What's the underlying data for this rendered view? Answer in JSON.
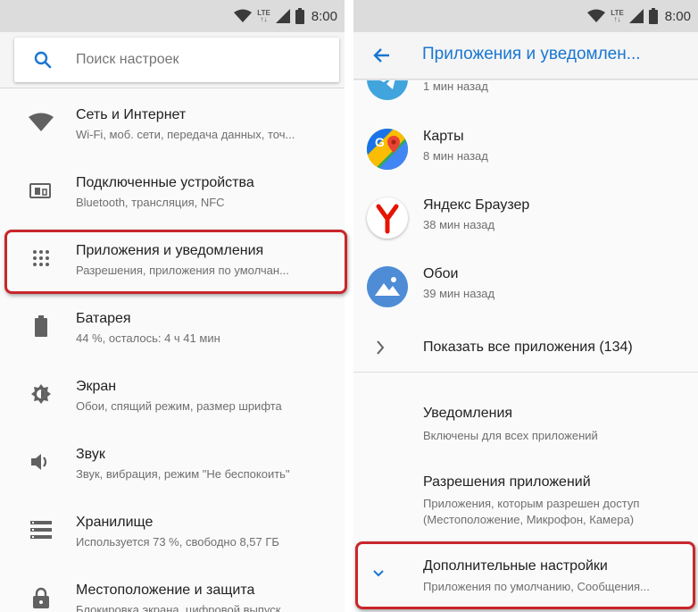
{
  "status": {
    "network": "LTE",
    "time": "8:00"
  },
  "left": {
    "search": {
      "placeholder": "Поиск настроек"
    },
    "items": [
      {
        "title": "Сеть и Интернет",
        "subtitle": "Wi-Fi, моб. сети, передача данных, точ...",
        "icon": "wifi-icon"
      },
      {
        "title": "Подключенные устройства",
        "subtitle": "Bluetooth, трансляция, NFC",
        "icon": "devices-icon"
      },
      {
        "title": "Приложения и уведомления",
        "subtitle": "Разрешения, приложения по умолчан...",
        "icon": "apps-icon"
      },
      {
        "title": "Батарея",
        "subtitle": "44 %, осталось: 4 ч 41 мин",
        "icon": "battery-icon"
      },
      {
        "title": "Экран",
        "subtitle": "Обои, спящий режим, размер шрифта",
        "icon": "brightness-icon"
      },
      {
        "title": "Звук",
        "subtitle": "Звук, вибрация, режим \"Не беспокоить\"",
        "icon": "volume-icon"
      },
      {
        "title": "Хранилище",
        "subtitle": "Используется 73 %, свободно 8,57 ГБ",
        "icon": "storage-icon"
      },
      {
        "title": "Местоположение и защита",
        "subtitle": "Блокировка экрана, цифровой выпуск...",
        "icon": "lock-icon"
      }
    ]
  },
  "right": {
    "title": "Приложения и уведомлен...",
    "apps": [
      {
        "name": "",
        "time": "1 мин назад",
        "icon": "telegram-icon"
      },
      {
        "name": "Карты",
        "time": "8 мин назад",
        "icon": "maps-icon"
      },
      {
        "name": "Яндекс Браузер",
        "time": "38 мин назад",
        "icon": "yandex-browser-icon"
      },
      {
        "name": "Обои",
        "time": "39 мин назад",
        "icon": "wallpapers-icon"
      }
    ],
    "show_all": "Показать все приложения (134)",
    "notifications": {
      "title": "Уведомления",
      "subtitle": "Включены для всех приложений"
    },
    "permissions": {
      "title": "Разрешения приложений",
      "subtitle1": "Приложения, которым разрешен доступ",
      "subtitle2": "(Местоположение, Микрофон, Камера)"
    },
    "advanced": {
      "title": "Дополнительные настройки",
      "subtitle": "Приложения по умолчанию, Сообщения..."
    }
  },
  "colors": {
    "accent": "#1976d2",
    "highlight": "#c8262c",
    "icon_gray": "#616161"
  }
}
